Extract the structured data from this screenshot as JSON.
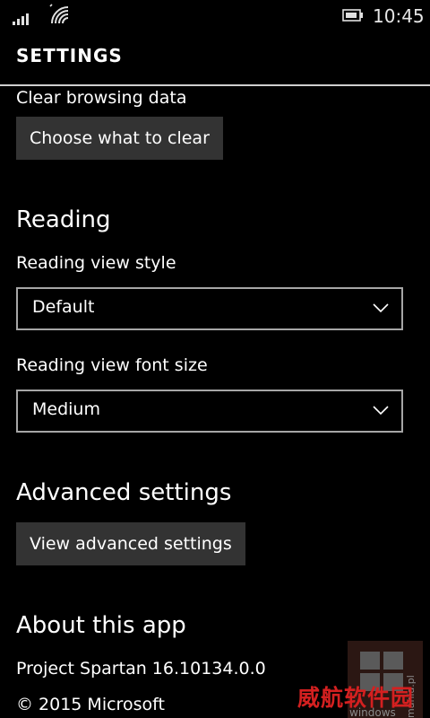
{
  "status_bar": {
    "time": "10:45",
    "signal_icon": "signal-bars-icon",
    "wifi_icon": "wifi-icon",
    "battery_icon": "battery-icon"
  },
  "header": {
    "title": "SETTINGS"
  },
  "clear_browsing": {
    "label": "Clear browsing data",
    "button_label": "Choose what to clear"
  },
  "reading": {
    "heading": "Reading",
    "style_label": "Reading view style",
    "style_value": "Default",
    "font_size_label": "Reading view font size",
    "font_size_value": "Medium"
  },
  "advanced": {
    "heading": "Advanced settings",
    "button_label": "View advanced settings"
  },
  "about": {
    "heading": "About this app",
    "version": "Project Spartan 16.10134.0.0",
    "copyright": "© 2015 Microsoft"
  },
  "watermark": {
    "logo_text": "windowsmania.pl",
    "cn_text": "威航软件园"
  },
  "colors": {
    "background": "#000000",
    "text": "#ffffff",
    "button_bg": "#333333",
    "combo_border": "#a6a6a6",
    "watermark_red": "#d42020"
  }
}
